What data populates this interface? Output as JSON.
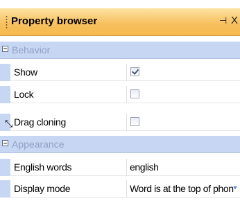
{
  "panel": {
    "title": "Property browser",
    "pin_glyph": "⊣",
    "close_glyph": "X"
  },
  "categories": {
    "behavior": "Behavior",
    "appearance": "Appearance"
  },
  "properties": {
    "show": {
      "name": "Show",
      "checked": true
    },
    "lock": {
      "name": "Lock",
      "checked": false
    },
    "drag_cloning": {
      "name": "Drag cloning",
      "checked": false
    },
    "english_words": {
      "name": "English words",
      "value": "english"
    },
    "display_mode": {
      "name": "Display mode",
      "value": "Word is at the top of phon"
    }
  },
  "colors": {
    "titlebar": "#f7c160",
    "category_bg": "#c7d7f3",
    "category_text": "#8fa0c4"
  }
}
